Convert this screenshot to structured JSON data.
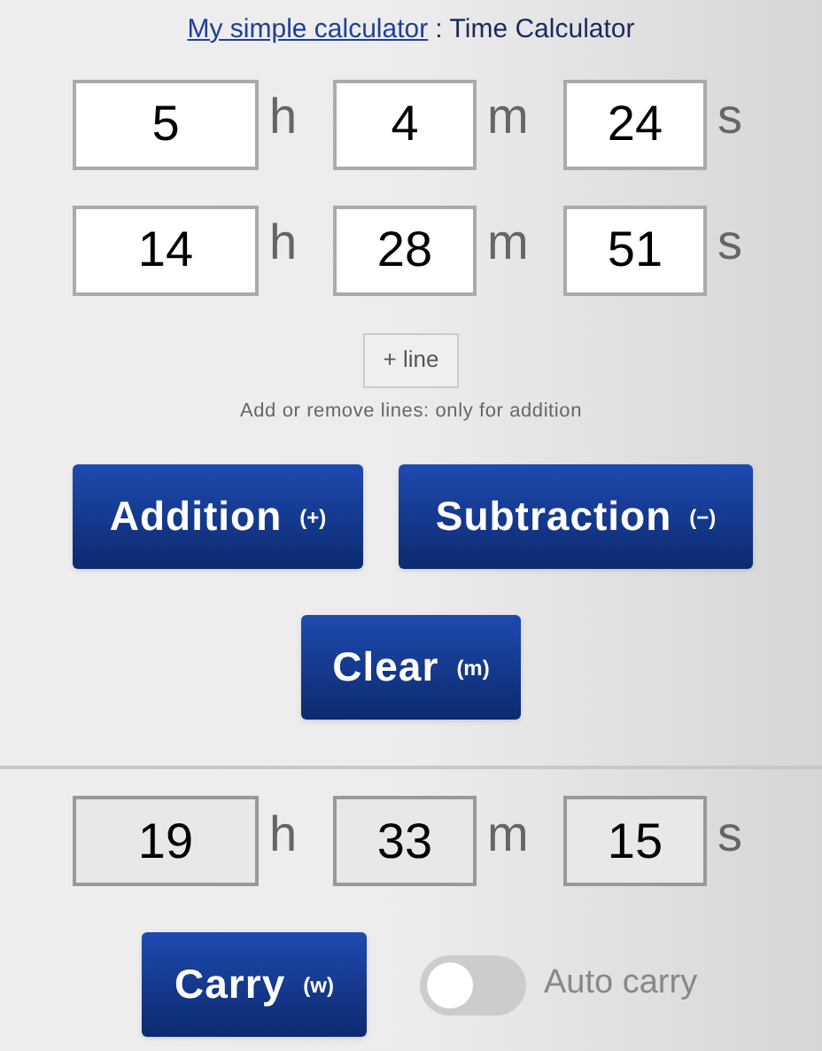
{
  "header": {
    "link": "My simple calculator",
    "separator": ":",
    "title": "Time Calculator"
  },
  "input_rows": [
    {
      "fields": [
        {
          "value": "5",
          "unit": "h"
        },
        {
          "value": "4",
          "unit": "m"
        },
        {
          "value": "24",
          "unit": "s"
        }
      ]
    },
    {
      "fields": [
        {
          "value": "14",
          "unit": "h"
        },
        {
          "value": "28",
          "unit": "m"
        },
        {
          "value": "51",
          "unit": "s"
        }
      ]
    }
  ],
  "add_line_button": "+ line",
  "hint": "Add or remove lines: only for addition",
  "operation_buttons": [
    {
      "label": "Addition",
      "shortcut": "(+)"
    },
    {
      "label": "Subtraction",
      "shortcut": "(−)"
    }
  ],
  "clear_button": {
    "label": "Clear",
    "shortcut": "(m)"
  },
  "result": {
    "fields": [
      {
        "value": "19",
        "unit": "h"
      },
      {
        "value": "33",
        "unit": "m"
      },
      {
        "value": "15",
        "unit": "s"
      }
    ]
  },
  "carry_button": {
    "label": "Carry",
    "shortcut": "(w)"
  },
  "auto_carry": {
    "label": "Auto carry",
    "on": false
  }
}
